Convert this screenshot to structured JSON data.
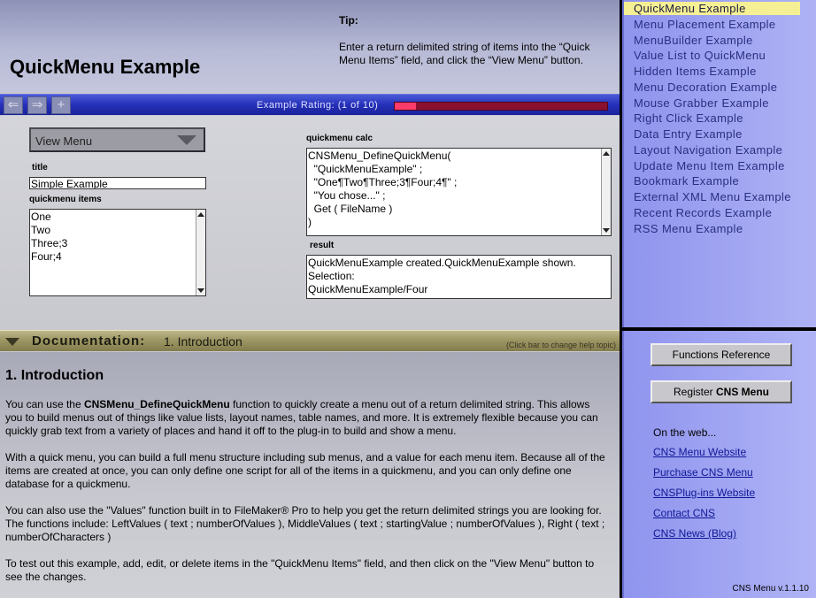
{
  "header": {
    "title": "QuickMenu Example",
    "tip_heading": "Tip:",
    "tip_text": "Enter a return delimited string of items into the “Quick Menu Items” field, and click the “View Menu” button."
  },
  "toolbar": {
    "back_label": "⇐",
    "forward_label": "⇒",
    "add_label": "+",
    "rating_label": "Example Rating: (1 of 10)",
    "rating_value": 1,
    "rating_max": 10
  },
  "example": {
    "view_menu_label": "View Menu",
    "title_label": "title",
    "title_value": "Simple Example",
    "items_label": "quickmenu items",
    "items": [
      "One",
      "Two",
      "Three;3",
      "Four;4"
    ],
    "calc_label": "quickmenu calc",
    "calc_lines": [
      "CNSMenu_DefineQuickMenu(",
      "  \"QuickMenuExample\" ;",
      "  \"One¶Two¶Three;3¶Four;4¶\" ;",
      "  \"You chose...\" ;",
      "  Get ( FileName )",
      ")"
    ],
    "result_label": "result",
    "result_lines": [
      "QuickMenuExample created.QuickMenuExample shown.",
      "Selection:",
      "QuickMenuExample/Four"
    ]
  },
  "documentation": {
    "bar_heading": "Documentation:",
    "bar_topic": "1. Introduction",
    "bar_hint": "(Click bar to change help topic)",
    "title": "1. Introduction",
    "p1_pre": "You can use the ",
    "p1_bold": "CNSMenu_DefineQuickMenu",
    "p1_post": " function to quickly create a menu out of a return delimited string. This allows you to build menus out of things like value lists, layout names, table names, and more.  It is extremely flexible because you can quickly grab text from a variety of places and hand it off to the plug-in to build and show a menu.",
    "p2": "With a quick menu, you can build a full menu structure including sub menus, and a value for each menu item.  Because all of the items are created at once, you can only define one script for all of the items in a quickmenu, and you can only define one database for a quickmenu.",
    "p3": "You can also use the \"Values\" function built in to FileMaker® Pro to help you get the return delimited strings you are looking for.  The functions include: LeftValues ( text ; numberOfValues ), MiddleValues ( text ; startingValue ; numberOfValues ), Right ( text ; numberOfCharacters )",
    "p4": "To test out this example, add, edit, or delete items in the \"QuickMenu Items\" field, and then click on the \"View Menu\" button to see the changes."
  },
  "sidebar": {
    "menu_items": [
      "QuickMenu Example",
      "Menu Placement Example",
      "MenuBuilder Example",
      "Value List to QuickMenu",
      "Hidden Items Example",
      "Menu Decoration Example",
      "Mouse Grabber Example",
      "Right Click Example",
      "Data Entry Example",
      "Layout Navigation Example",
      "Update Menu Item Example",
      "Bookmark Example",
      "External XML Menu Example",
      "Recent Records Example",
      "RSS Menu Example"
    ],
    "functions_ref_label": "Functions Reference",
    "register_pre": "Register ",
    "register_bold": "CNS Menu",
    "web_label": "On the web...",
    "links": [
      "CNS Menu Website",
      "Purchase CNS Menu",
      "CNSPlug-ins Website",
      "Contact CNS",
      "CNS News (Blog)"
    ],
    "version": "CNS Menu v.1.1.10"
  }
}
